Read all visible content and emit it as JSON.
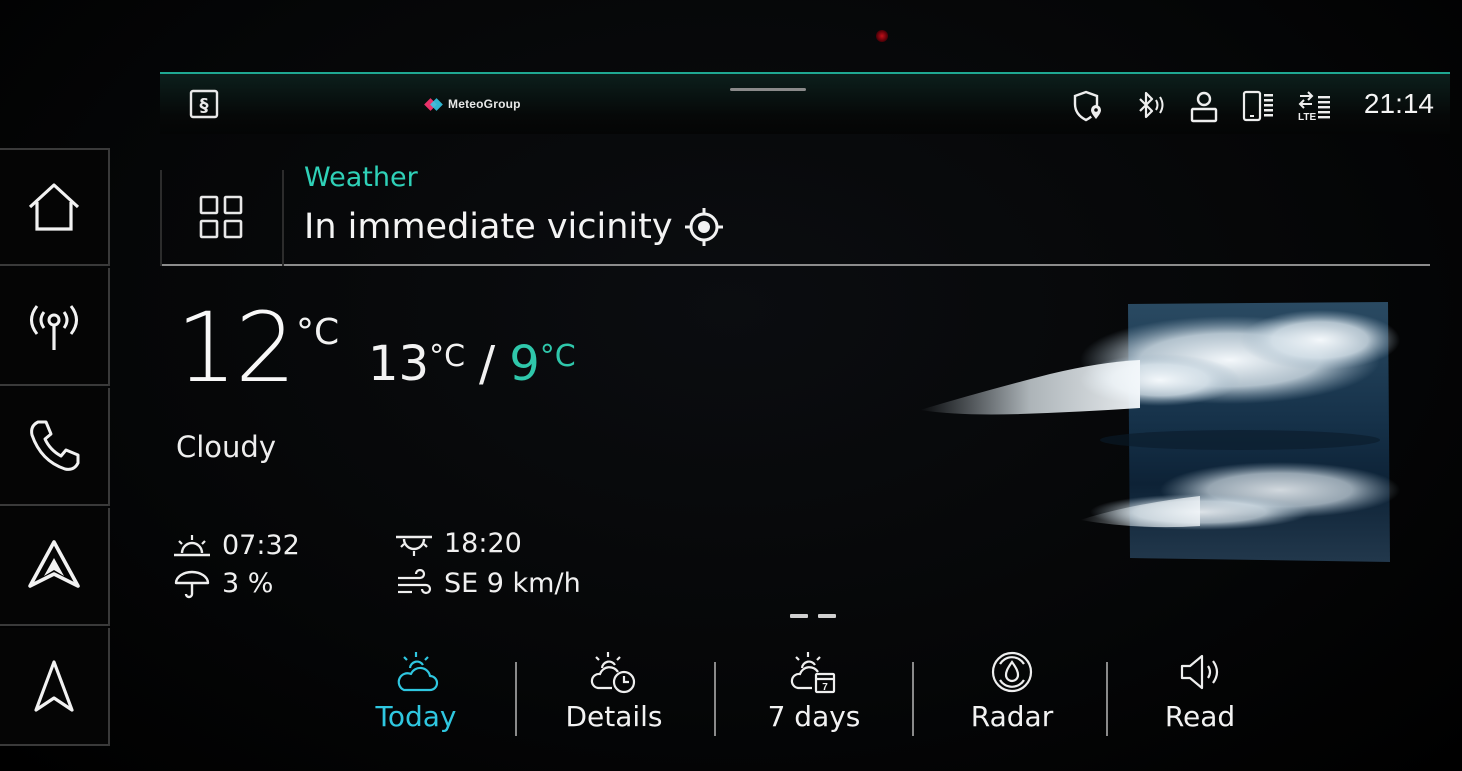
{
  "status_bar": {
    "brand": "MeteoGroup",
    "time": "21:14",
    "icons": [
      "smart-app-s-icon",
      "privacy-shield-location-icon",
      "bluetooth-audio-icon",
      "user-profile-icon",
      "phone-signal-icon",
      "lte-data-icon"
    ],
    "accent_color": "#1fa892"
  },
  "left_nav": {
    "items": [
      {
        "name": "home",
        "icon": "home-icon"
      },
      {
        "name": "radio",
        "icon": "radio-antenna-icon"
      },
      {
        "name": "phone",
        "icon": "phone-icon"
      },
      {
        "name": "android-auto",
        "icon": "android-auto-icon"
      },
      {
        "name": "navigation",
        "icon": "navigation-arrow-icon"
      }
    ]
  },
  "header": {
    "app_title": "Weather",
    "location": "In immediate vicinity",
    "location_icon": "crosshair-locate-icon",
    "apps_icon": "app-grid-icon"
  },
  "weather": {
    "current_temp": "12",
    "current_unit": "°C",
    "high": "13",
    "high_unit": "°C",
    "separator": "/",
    "low": "9",
    "low_unit": "°C",
    "condition": "Cloudy",
    "sunrise": "07:32",
    "sunset": "18:20",
    "precipitation": "3 %",
    "wind": "SE 9 km/h",
    "condition_icon": "cloud-illustration",
    "low_color": "#2fc7ab"
  },
  "tabs": [
    {
      "label": "Today",
      "icon": "sun-cloud-icon",
      "active": true
    },
    {
      "label": "Details",
      "icon": "sun-cloud-clock-icon",
      "active": false
    },
    {
      "label": "7 days",
      "icon": "sun-cloud-calendar-icon",
      "active": false
    },
    {
      "label": "Radar",
      "icon": "radar-drop-icon",
      "active": false
    },
    {
      "label": "Read",
      "icon": "speaker-icon",
      "active": false
    }
  ],
  "active_color": "#2fc7e0"
}
